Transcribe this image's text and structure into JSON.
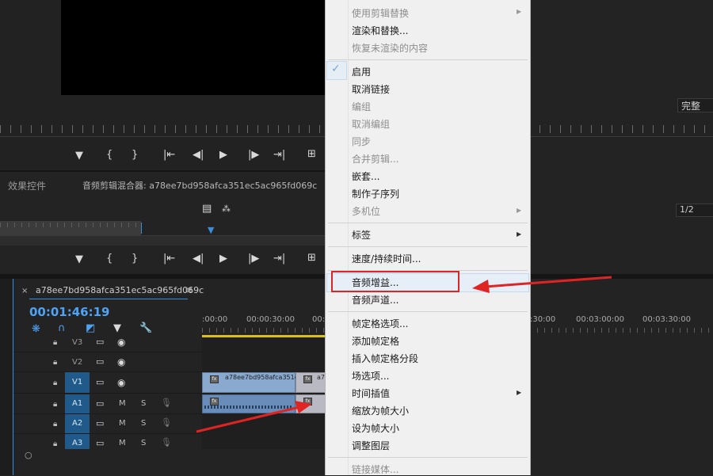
{
  "program_monitor": {
    "fit_label": "完整"
  },
  "effects_panel": {
    "tab_effect_controls": "效果控件",
    "tab_audio_clip_mixer": "音频剪辑混合器: a78ee7bd958afca351ec5ac965fd069c",
    "page_indicator": "1/2"
  },
  "timeline": {
    "sequence_name": "a78ee7bd958afca351ec5ac965fd069c",
    "timecode": "00:01:46:19",
    "ruler_labels": [
      ":00:00",
      "00:00:30:00",
      "00:0",
      ":30:00",
      "00:03:00:00",
      "00:03:30:00"
    ],
    "tracks": [
      {
        "name": "V3",
        "kind": "video"
      },
      {
        "name": "V2",
        "kind": "video"
      },
      {
        "name": "V1",
        "kind": "video"
      },
      {
        "name": "A1",
        "kind": "audio"
      },
      {
        "name": "A2",
        "kind": "audio"
      },
      {
        "name": "A3",
        "kind": "audio"
      }
    ],
    "mute_label": "M",
    "solo_label": "S",
    "clip_label_v1": "a78ee7bd958afca351e",
    "clip_label_v1_b": "a7",
    "fx_label": "fx"
  },
  "context_menu": {
    "items": [
      {
        "label": "使用剪辑替换",
        "disabled": true,
        "submenu": true
      },
      {
        "label": "渲染和替换...",
        "disabled": false
      },
      {
        "label": "恢复未渲染的内容",
        "disabled": true
      },
      {
        "label": "启用",
        "disabled": false,
        "checked": true
      },
      {
        "label": "取消链接",
        "disabled": false
      },
      {
        "label": "编组",
        "disabled": true
      },
      {
        "label": "取消编组",
        "disabled": true
      },
      {
        "label": "同步",
        "disabled": true
      },
      {
        "label": "合并剪辑...",
        "disabled": true
      },
      {
        "label": "嵌套...",
        "disabled": false
      },
      {
        "label": "制作子序列",
        "disabled": false
      },
      {
        "label": "多机位",
        "disabled": true,
        "submenu": true
      },
      {
        "label": "标签",
        "disabled": false,
        "submenu": true
      },
      {
        "label": "速度/持续时间...",
        "disabled": false
      },
      {
        "label": "音频增益...",
        "disabled": false,
        "highlighted": true
      },
      {
        "label": "音频声道...",
        "disabled": false
      },
      {
        "label": "帧定格选项...",
        "disabled": false
      },
      {
        "label": "添加帧定格",
        "disabled": false
      },
      {
        "label": "插入帧定格分段",
        "disabled": false
      },
      {
        "label": "场选项...",
        "disabled": false
      },
      {
        "label": "时间插值",
        "disabled": false,
        "submenu": true
      },
      {
        "label": "缩放为帧大小",
        "disabled": false
      },
      {
        "label": "设为帧大小",
        "disabled": false
      },
      {
        "label": "调整图层",
        "disabled": false
      },
      {
        "label": "链接媒体...",
        "disabled": true
      }
    ],
    "check_mark": "✓"
  },
  "colors": {
    "accent_blue": "#3e8dd6",
    "timecode_blue": "#4fa3f5",
    "annotation_red": "#e02424",
    "menu_bg": "#f0f0f0"
  }
}
